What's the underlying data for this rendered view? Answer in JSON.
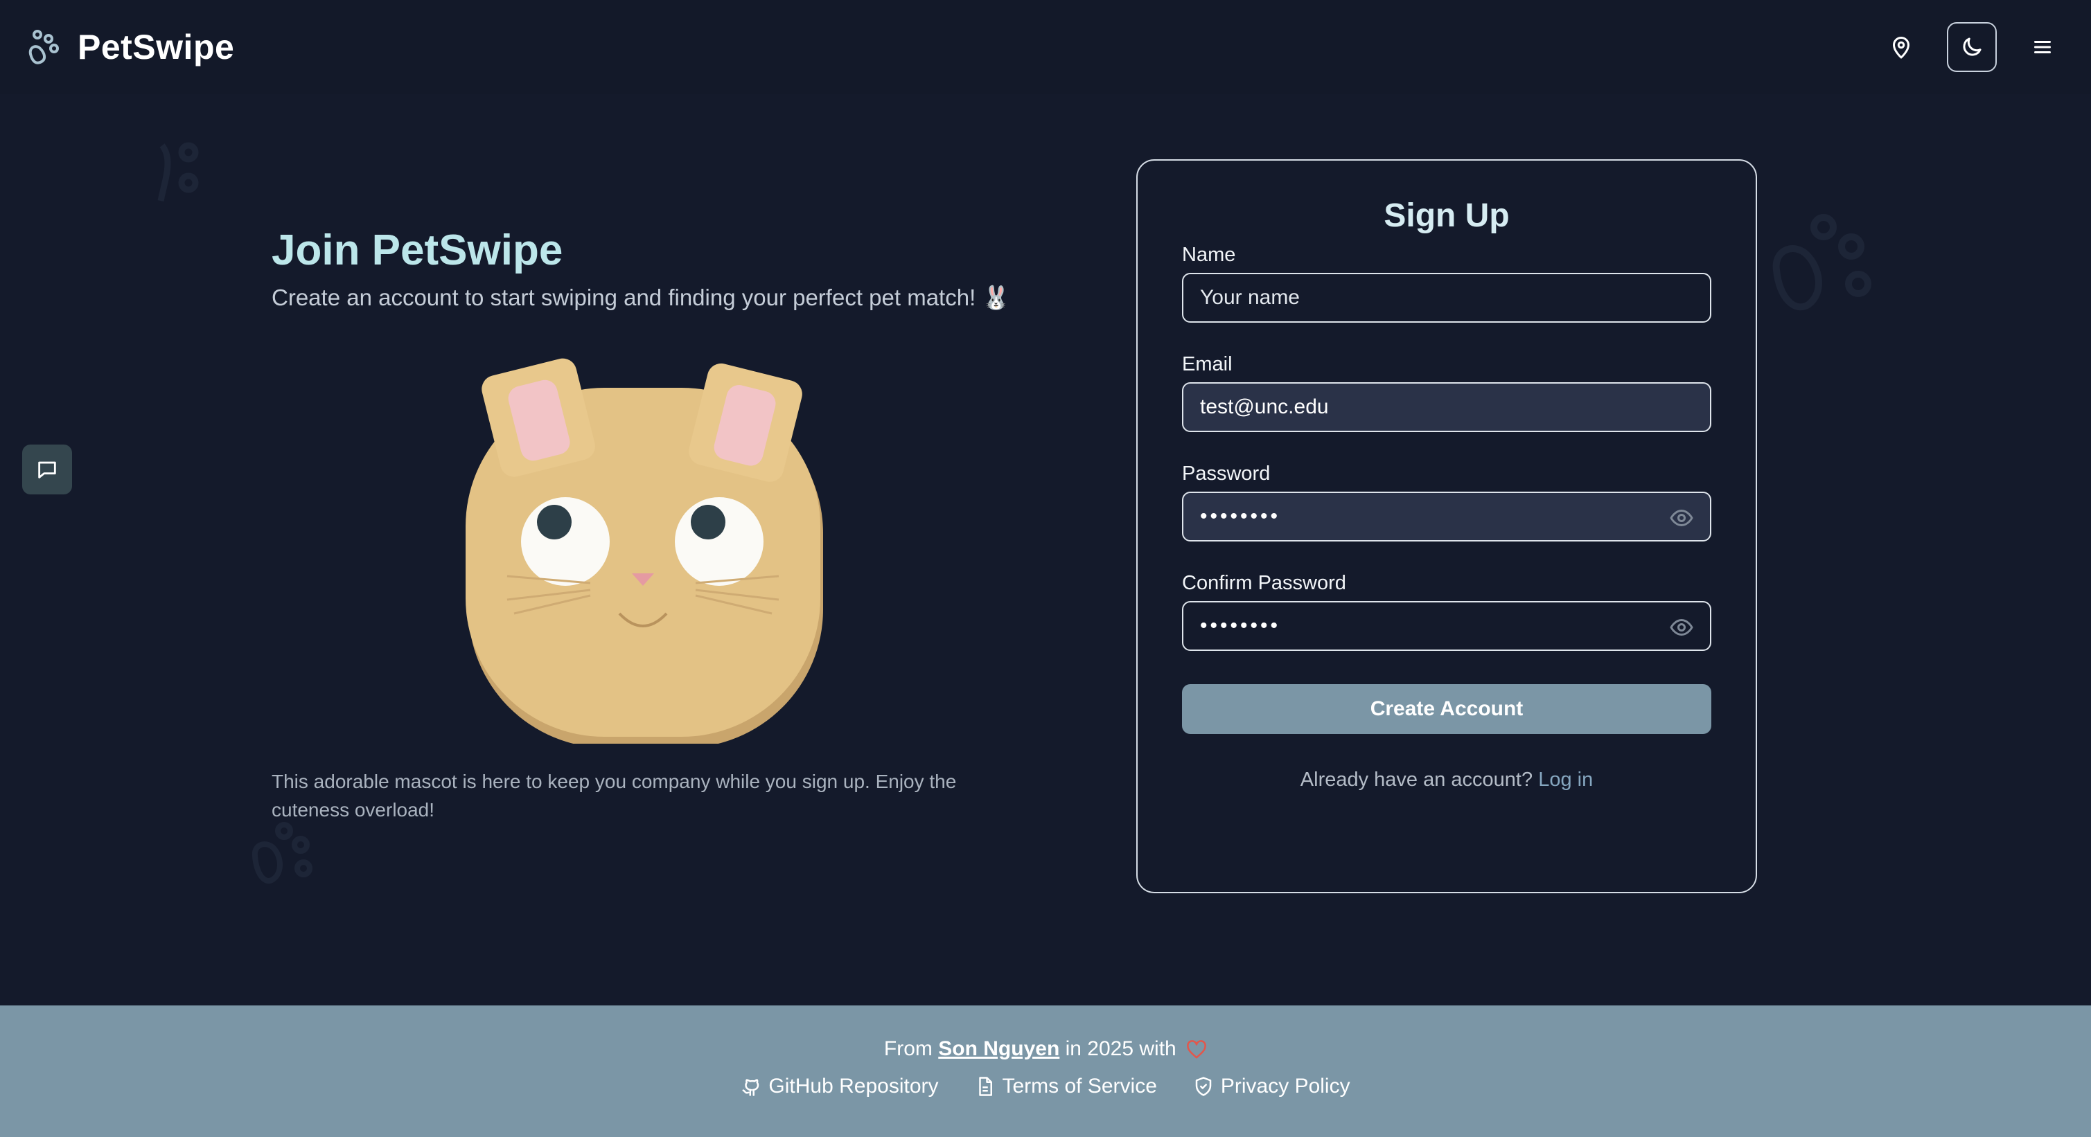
{
  "header": {
    "brand": "PetSwipe",
    "icons": [
      "paw-icon",
      "map-pin-icon",
      "moon-icon",
      "menu-icon"
    ]
  },
  "intro": {
    "title": "Join PetSwipe",
    "subtitle": "Create an account to start swiping and finding your perfect pet match! 🐰",
    "caption": "This adorable mascot is here to keep you company while you sign up. Enjoy the cuteness overload!"
  },
  "signup": {
    "title": "Sign Up",
    "name_label": "Name",
    "name_placeholder": "Your name",
    "email_label": "Email",
    "email_value": "test@unc.edu",
    "password_label": "Password",
    "password_dots": "••••••••",
    "confirm_label": "Confirm Password",
    "confirm_dots": "••••••••",
    "submit_label": "Create Account",
    "login_prompt": "Already have an account?",
    "login_link": "Log in"
  },
  "footer": {
    "from_text": "From",
    "author": "Son Nguyen",
    "year_text": "in 2025 with",
    "links": {
      "github": "GitHub Repository",
      "terms": "Terms of Service",
      "privacy": "Privacy Policy"
    }
  },
  "colors": {
    "background": "#141a2b",
    "accent_teal": "#bce6ea",
    "button": "#7b96a6",
    "footer": "#7b96a6",
    "mascot": "#e3c285",
    "heart": "#e2574c"
  }
}
